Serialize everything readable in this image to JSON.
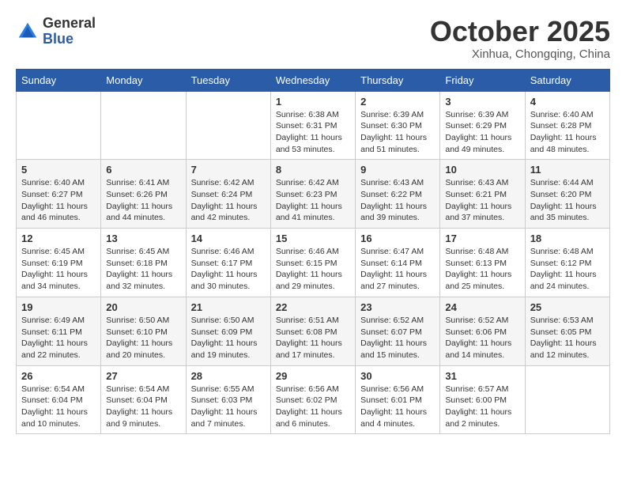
{
  "header": {
    "logo_general": "General",
    "logo_blue": "Blue",
    "month_title": "October 2025",
    "subtitle": "Xinhua, Chongqing, China"
  },
  "days_of_week": [
    "Sunday",
    "Monday",
    "Tuesday",
    "Wednesday",
    "Thursday",
    "Friday",
    "Saturday"
  ],
  "weeks": [
    [
      {
        "day": "",
        "info": ""
      },
      {
        "day": "",
        "info": ""
      },
      {
        "day": "",
        "info": ""
      },
      {
        "day": "1",
        "info": "Sunrise: 6:38 AM\nSunset: 6:31 PM\nDaylight: 11 hours and 53 minutes."
      },
      {
        "day": "2",
        "info": "Sunrise: 6:39 AM\nSunset: 6:30 PM\nDaylight: 11 hours and 51 minutes."
      },
      {
        "day": "3",
        "info": "Sunrise: 6:39 AM\nSunset: 6:29 PM\nDaylight: 11 hours and 49 minutes."
      },
      {
        "day": "4",
        "info": "Sunrise: 6:40 AM\nSunset: 6:28 PM\nDaylight: 11 hours and 48 minutes."
      }
    ],
    [
      {
        "day": "5",
        "info": "Sunrise: 6:40 AM\nSunset: 6:27 PM\nDaylight: 11 hours and 46 minutes."
      },
      {
        "day": "6",
        "info": "Sunrise: 6:41 AM\nSunset: 6:26 PM\nDaylight: 11 hours and 44 minutes."
      },
      {
        "day": "7",
        "info": "Sunrise: 6:42 AM\nSunset: 6:24 PM\nDaylight: 11 hours and 42 minutes."
      },
      {
        "day": "8",
        "info": "Sunrise: 6:42 AM\nSunset: 6:23 PM\nDaylight: 11 hours and 41 minutes."
      },
      {
        "day": "9",
        "info": "Sunrise: 6:43 AM\nSunset: 6:22 PM\nDaylight: 11 hours and 39 minutes."
      },
      {
        "day": "10",
        "info": "Sunrise: 6:43 AM\nSunset: 6:21 PM\nDaylight: 11 hours and 37 minutes."
      },
      {
        "day": "11",
        "info": "Sunrise: 6:44 AM\nSunset: 6:20 PM\nDaylight: 11 hours and 35 minutes."
      }
    ],
    [
      {
        "day": "12",
        "info": "Sunrise: 6:45 AM\nSunset: 6:19 PM\nDaylight: 11 hours and 34 minutes."
      },
      {
        "day": "13",
        "info": "Sunrise: 6:45 AM\nSunset: 6:18 PM\nDaylight: 11 hours and 32 minutes."
      },
      {
        "day": "14",
        "info": "Sunrise: 6:46 AM\nSunset: 6:17 PM\nDaylight: 11 hours and 30 minutes."
      },
      {
        "day": "15",
        "info": "Sunrise: 6:46 AM\nSunset: 6:15 PM\nDaylight: 11 hours and 29 minutes."
      },
      {
        "day": "16",
        "info": "Sunrise: 6:47 AM\nSunset: 6:14 PM\nDaylight: 11 hours and 27 minutes."
      },
      {
        "day": "17",
        "info": "Sunrise: 6:48 AM\nSunset: 6:13 PM\nDaylight: 11 hours and 25 minutes."
      },
      {
        "day": "18",
        "info": "Sunrise: 6:48 AM\nSunset: 6:12 PM\nDaylight: 11 hours and 24 minutes."
      }
    ],
    [
      {
        "day": "19",
        "info": "Sunrise: 6:49 AM\nSunset: 6:11 PM\nDaylight: 11 hours and 22 minutes."
      },
      {
        "day": "20",
        "info": "Sunrise: 6:50 AM\nSunset: 6:10 PM\nDaylight: 11 hours and 20 minutes."
      },
      {
        "day": "21",
        "info": "Sunrise: 6:50 AM\nSunset: 6:09 PM\nDaylight: 11 hours and 19 minutes."
      },
      {
        "day": "22",
        "info": "Sunrise: 6:51 AM\nSunset: 6:08 PM\nDaylight: 11 hours and 17 minutes."
      },
      {
        "day": "23",
        "info": "Sunrise: 6:52 AM\nSunset: 6:07 PM\nDaylight: 11 hours and 15 minutes."
      },
      {
        "day": "24",
        "info": "Sunrise: 6:52 AM\nSunset: 6:06 PM\nDaylight: 11 hours and 14 minutes."
      },
      {
        "day": "25",
        "info": "Sunrise: 6:53 AM\nSunset: 6:05 PM\nDaylight: 11 hours and 12 minutes."
      }
    ],
    [
      {
        "day": "26",
        "info": "Sunrise: 6:54 AM\nSunset: 6:04 PM\nDaylight: 11 hours and 10 minutes."
      },
      {
        "day": "27",
        "info": "Sunrise: 6:54 AM\nSunset: 6:04 PM\nDaylight: 11 hours and 9 minutes."
      },
      {
        "day": "28",
        "info": "Sunrise: 6:55 AM\nSunset: 6:03 PM\nDaylight: 11 hours and 7 minutes."
      },
      {
        "day": "29",
        "info": "Sunrise: 6:56 AM\nSunset: 6:02 PM\nDaylight: 11 hours and 6 minutes."
      },
      {
        "day": "30",
        "info": "Sunrise: 6:56 AM\nSunset: 6:01 PM\nDaylight: 11 hours and 4 minutes."
      },
      {
        "day": "31",
        "info": "Sunrise: 6:57 AM\nSunset: 6:00 PM\nDaylight: 11 hours and 2 minutes."
      },
      {
        "day": "",
        "info": ""
      }
    ]
  ]
}
